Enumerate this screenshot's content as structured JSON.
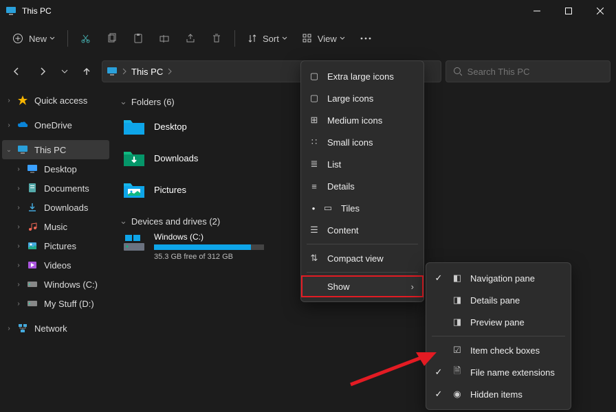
{
  "window": {
    "title": "This PC"
  },
  "toolbar": {
    "new": "New",
    "sort": "Sort",
    "view": "View"
  },
  "breadcrumb": {
    "current": "This PC"
  },
  "search": {
    "placeholder": "Search This PC"
  },
  "sidebar": {
    "quick_access": "Quick access",
    "onedrive": "OneDrive",
    "this_pc": "This PC",
    "desktop": "Desktop",
    "documents": "Documents",
    "downloads": "Downloads",
    "music": "Music",
    "pictures": "Pictures",
    "videos": "Videos",
    "windows_c": "Windows (C:)",
    "my_stuff_d": "My Stuff (D:)",
    "network": "Network"
  },
  "content": {
    "folders_header": "Folders (6)",
    "devices_header": "Devices and drives (2)",
    "folders": {
      "desktop": "Desktop",
      "downloads": "Downloads",
      "pictures": "Pictures"
    },
    "drive": {
      "name": "Windows (C:)",
      "free": "35.3 GB free of 312 GB",
      "fill_pct": 88
    }
  },
  "menu_view": {
    "xl": "Extra large icons",
    "lg": "Large icons",
    "md": "Medium icons",
    "sm": "Small icons",
    "list": "List",
    "details": "Details",
    "tiles": "Tiles",
    "content": "Content",
    "compact": "Compact view",
    "show": "Show"
  },
  "menu_show": {
    "nav": "Navigation pane",
    "details": "Details pane",
    "preview": "Preview pane",
    "checkboxes": "Item check boxes",
    "ext": "File name extensions",
    "hidden": "Hidden items"
  }
}
